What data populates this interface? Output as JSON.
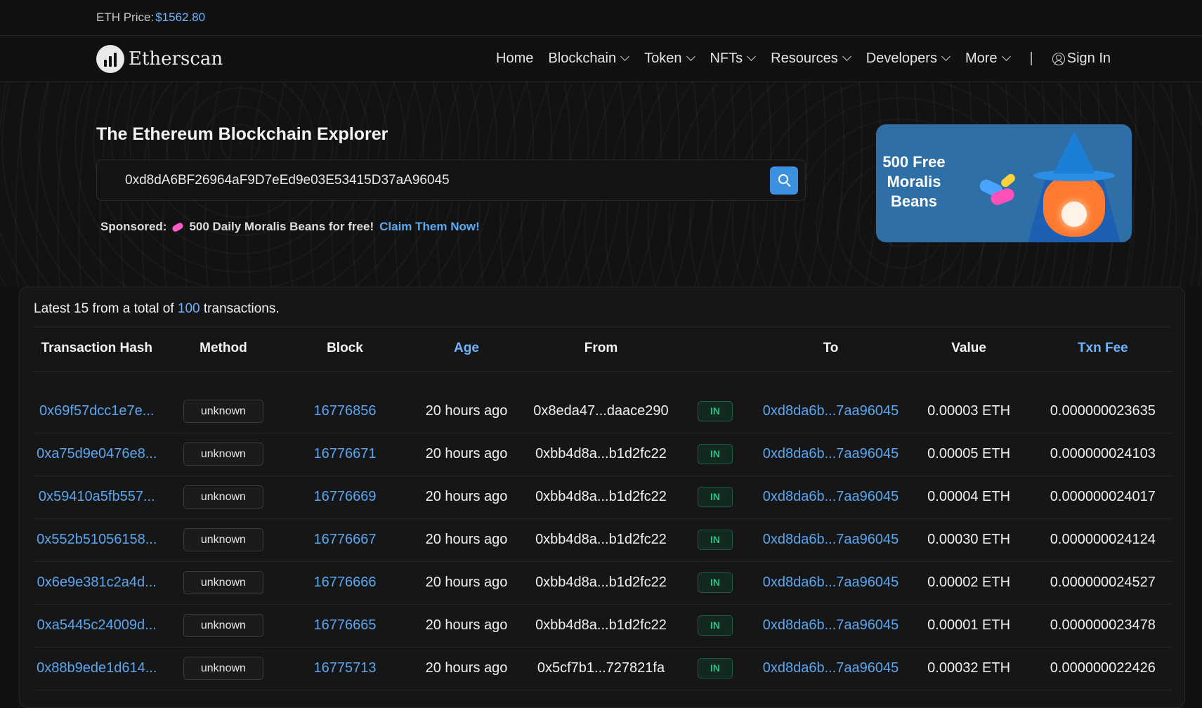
{
  "topbar": {
    "price_label": "ETH Price:",
    "price_value": "$1562.80"
  },
  "nav": {
    "brand": "Etherscan",
    "items": [
      {
        "label": "Home",
        "dropdown": false
      },
      {
        "label": "Blockchain",
        "dropdown": true
      },
      {
        "label": "Token",
        "dropdown": true
      },
      {
        "label": "NFTs",
        "dropdown": true
      },
      {
        "label": "Resources",
        "dropdown": true
      },
      {
        "label": "Developers",
        "dropdown": true
      },
      {
        "label": "More",
        "dropdown": true
      }
    ],
    "separator": "|",
    "sign_in": "Sign In"
  },
  "hero": {
    "title": "The Ethereum Blockchain Explorer",
    "search_value": "0xd8dA6BF26964aF9D7eEd9e03E53415D37aA96045",
    "sponsored_label": "Sponsored:",
    "sponsored_text": "500 Daily Moralis Beans for free!",
    "sponsored_link": "Claim Them Now!"
  },
  "ad": {
    "line1": "500 Free",
    "line2": "Moralis",
    "line3": "Beans"
  },
  "summary": {
    "prefix": "Latest 15 from a total of",
    "count": "100",
    "suffix": "transactions."
  },
  "table": {
    "headers": {
      "hash": "Transaction Hash",
      "method": "Method",
      "block": "Block",
      "age": "Age",
      "from": "From",
      "to": "To",
      "value": "Value",
      "fee": "Txn Fee"
    },
    "rows": [
      {
        "hash": "0x69f57dcc1e7e...",
        "method": "unknown",
        "block": "16776856",
        "age": "20 hours ago",
        "from": "0x8eda47...daace290",
        "dir": "IN",
        "to": "0xd8da6b...7aa96045",
        "value": "0.00003 ETH",
        "fee": "0.000000023635"
      },
      {
        "hash": "0xa75d9e0476e8...",
        "method": "unknown",
        "block": "16776671",
        "age": "20 hours ago",
        "from": "0xbb4d8a...b1d2fc22",
        "dir": "IN",
        "to": "0xd8da6b...7aa96045",
        "value": "0.00005 ETH",
        "fee": "0.000000024103"
      },
      {
        "hash": "0x59410a5fb557...",
        "method": "unknown",
        "block": "16776669",
        "age": "20 hours ago",
        "from": "0xbb4d8a...b1d2fc22",
        "dir": "IN",
        "to": "0xd8da6b...7aa96045",
        "value": "0.00004 ETH",
        "fee": "0.000000024017"
      },
      {
        "hash": "0x552b51056158...",
        "method": "unknown",
        "block": "16776667",
        "age": "20 hours ago",
        "from": "0xbb4d8a...b1d2fc22",
        "dir": "IN",
        "to": "0xd8da6b...7aa96045",
        "value": "0.00030 ETH",
        "fee": "0.000000024124"
      },
      {
        "hash": "0x6e9e381c2a4d...",
        "method": "unknown",
        "block": "16776666",
        "age": "20 hours ago",
        "from": "0xbb4d8a...b1d2fc22",
        "dir": "IN",
        "to": "0xd8da6b...7aa96045",
        "value": "0.00002 ETH",
        "fee": "0.000000024527"
      },
      {
        "hash": "0xa5445c24009d...",
        "method": "unknown",
        "block": "16776665",
        "age": "20 hours ago",
        "from": "0xbb4d8a...b1d2fc22",
        "dir": "IN",
        "to": "0xd8da6b...7aa96045",
        "value": "0.00001 ETH",
        "fee": "0.000000023478"
      },
      {
        "hash": "0x88b9ede1d614...",
        "method": "unknown",
        "block": "16775713",
        "age": "20 hours ago",
        "from": "0x5cf7b1...727821fa",
        "dir": "IN",
        "to": "0xd8da6b...7aa96045",
        "value": "0.00032 ETH",
        "fee": "0.000000022426"
      }
    ]
  }
}
